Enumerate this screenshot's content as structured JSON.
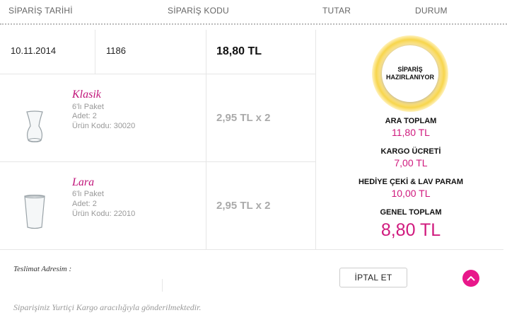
{
  "table_header": {
    "date": "SİPARİŞ TARİHİ",
    "code": "SİPARİŞ KODU",
    "amount": "TUTAR",
    "status": "DURUM"
  },
  "order": {
    "date": "10.11.2014",
    "code": "1186",
    "total": "18,80 TL",
    "status": "SİPARİŞ HAZIRLANIYOR"
  },
  "items": [
    {
      "name": "Klasik",
      "pack": "6'lı Paket",
      "qty": "Adet: 2",
      "code": "Ürün Kodu: 30020",
      "price": "2,95 TL x 2",
      "icon": "tea-glass-icon"
    },
    {
      "name": "Lara",
      "pack": "6'lı Paket",
      "qty": "Adet: 2",
      "code": "Ürün Kodu: 22010",
      "price": "2,95 TL x 2",
      "icon": "water-glass-icon"
    }
  ],
  "summary": {
    "subtotal_label": "ARA TOPLAM",
    "subtotal_value": "11,80 TL",
    "shipping_label": "KARGO ÜCRETİ",
    "shipping_value": "7,00 TL",
    "gift_label": "HEDİYE ÇEKİ & LAV PARAM",
    "gift_value": "10,00 TL",
    "grand_label": "GENEL TOPLAM",
    "grand_value": "8,80 TL"
  },
  "footer": {
    "address_label": "Teslimat Adresim :",
    "cancel_label": "İPTAL ET",
    "shipping_note": "Siparişiniz Yurtiçi Kargo aracılığıyla gönderilmektedir."
  },
  "colors": {
    "accent": "#d01a7e",
    "status_ring": "#f7d54c"
  }
}
